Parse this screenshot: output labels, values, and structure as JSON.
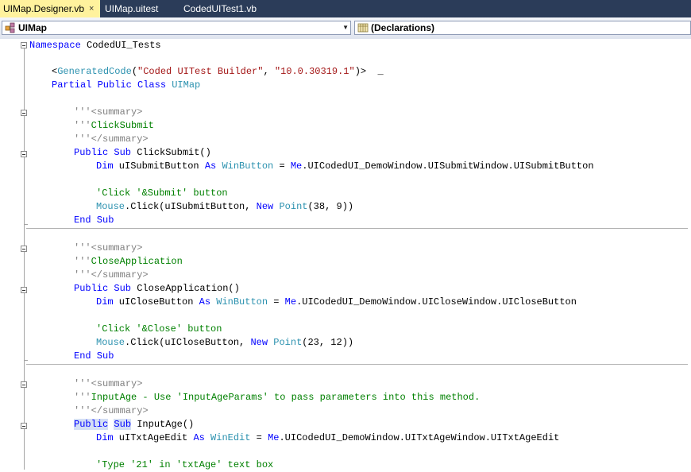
{
  "tabs": [
    {
      "label": "UIMap.Designer.vb",
      "active": true
    },
    {
      "label": "UIMap.uitest",
      "active": false
    },
    {
      "label": "CodedUITest1.vb",
      "active": false
    }
  ],
  "tab_close_glyph": "×",
  "navbar": {
    "type_combo": {
      "icon": "class-icon",
      "value": "UIMap"
    },
    "member_combo": {
      "icon": "declarations-icon",
      "value": "(Declarations)"
    }
  },
  "code": {
    "ns_kw": "Namespace",
    "ns_name": " CodedUI_Tests",
    "attr_open": "<",
    "attr_type": "GeneratedCode",
    "attr_paren": "(",
    "attr_str1": "\"Coded UITest Builder\"",
    "attr_comma": ", ",
    "attr_str2": "\"10.0.30319.1\"",
    "attr_close": ")>  _",
    "class_kw": "Partial Public Class",
    "class_name": "UIMap",
    "xml_prefix": "'''",
    "xml_summary_open": "<summary>",
    "xml_summary_close": "</summary>",
    "m1": {
      "doc": "ClickSubmit",
      "sig_kw": "Public Sub",
      "sig_rest": " ClickSubmit()",
      "dim_kw": "Dim",
      "dim_var": " uISubmitButton ",
      "as_kw": "As",
      "dim_type": "WinButton",
      "dim_eq": " = ",
      "me_kw": "Me",
      "dim_path": ".UICodedUI_DemoWindow.UISubmitWindow.UISubmitButton",
      "comment": "'Click '&Submit' button",
      "mouse": "Mouse",
      "click": ".Click(uISubmitButton, ",
      "new_kw": "New",
      "point_type": "Point",
      "args": "(38, 9))",
      "end": "End Sub"
    },
    "m2": {
      "doc": "CloseApplication",
      "sig_kw": "Public Sub",
      "sig_rest": " CloseApplication()",
      "dim_kw": "Dim",
      "dim_var": " uICloseButton ",
      "as_kw": "As",
      "dim_type": "WinButton",
      "dim_eq": " = ",
      "me_kw": "Me",
      "dim_path": ".UICodedUI_DemoWindow.UICloseWindow.UICloseButton",
      "comment": "'Click '&Close' button",
      "mouse": "Mouse",
      "click": ".Click(uICloseButton, ",
      "new_kw": "New",
      "point_type": "Point",
      "args": "(23, 12))",
      "end": "End Sub"
    },
    "m3": {
      "doc": "InputAge - Use 'InputAgeParams' to pass parameters into this method.",
      "sig_kw1": "Public",
      "sig_kw2": "Sub",
      "sig_rest": " InputAge()",
      "dim_kw": "Dim",
      "dim_var": " uITxtAgeEdit ",
      "as_kw": "As",
      "dim_type": "WinEdit",
      "dim_eq": " = ",
      "me_kw": "Me",
      "dim_path": ".UICodedUI_DemoWindow.UITxtAgeWindow.UITxtAgeEdit",
      "comment": "'Type '21' in 'txtAge' text box"
    }
  }
}
